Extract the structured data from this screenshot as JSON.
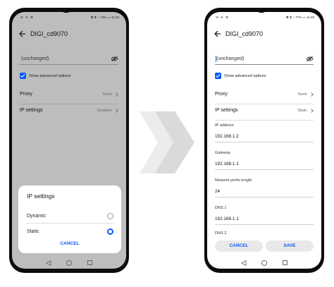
{
  "status_bar": {
    "left_icons": "✉ ✈ ⚙",
    "right_left_phone": "✱ ⧗ ◔ 76% ▭ 11:49",
    "right_right_phone": "✱ ⧗ ◔ 77% ▭ 11:49"
  },
  "network": {
    "title": "DIGI_cd9070",
    "password_value": "(unchanged)",
    "advanced_label": "Show advanced options",
    "proxy_label": "Proxy",
    "proxy_value": "None",
    "ip_settings_label": "IP settings"
  },
  "left_phone": {
    "ip_settings_value": "Dynamic",
    "dialog": {
      "title": "IP settings",
      "options": [
        {
          "label": "Dynamic",
          "selected": false
        },
        {
          "label": "Static",
          "selected": true
        }
      ],
      "cancel_label": "CANCEL"
    }
  },
  "right_phone": {
    "ip_settings_value": "Static",
    "fields": [
      {
        "label": "IP address",
        "value": "192.168.1.2"
      },
      {
        "label": "Gateway",
        "value": "192.168.1.1"
      },
      {
        "label": "Network prefix length",
        "value": "24"
      },
      {
        "label": "DNS 1",
        "value": "192.168.1.1"
      },
      {
        "label": "DNS 2",
        "value": ""
      }
    ],
    "cancel_label": "CANCEL",
    "save_label": "SAVE"
  },
  "colors": {
    "accent": "#0a59f7",
    "dimmed_background": "#bdbdbd",
    "arrow_light": "#ececec",
    "arrow_dark": "#dadada"
  }
}
